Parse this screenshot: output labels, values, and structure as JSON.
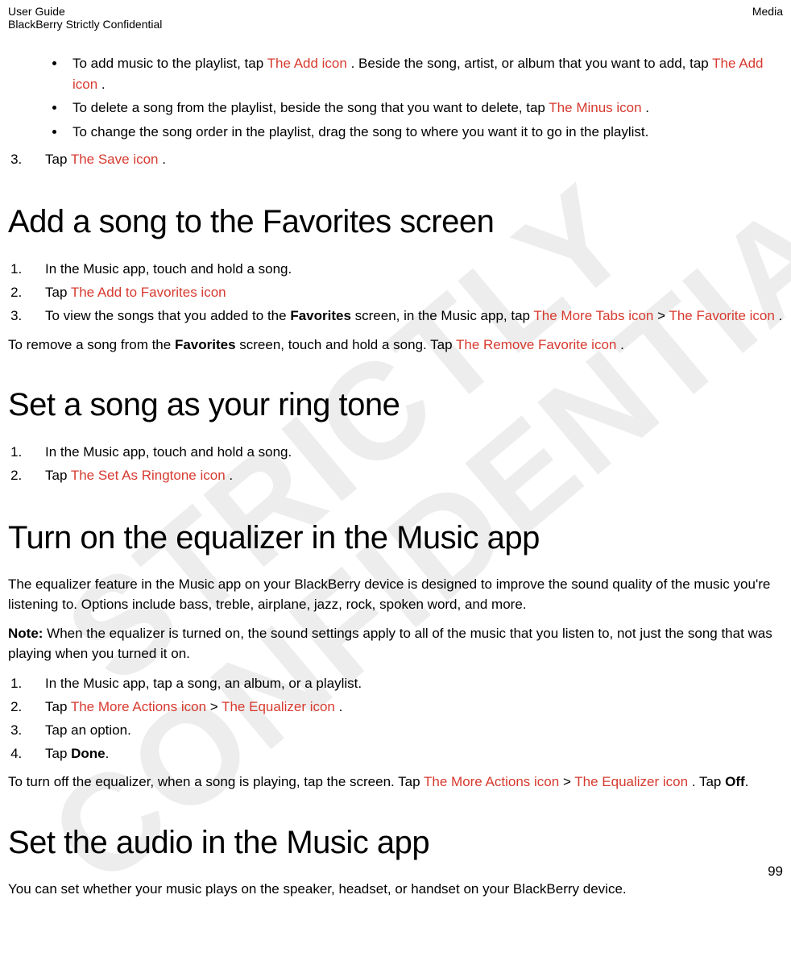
{
  "header": {
    "left1": "User Guide",
    "left2": "BlackBerry Strictly Confidential",
    "right": "Media"
  },
  "watermark": {
    "line1": "STRICTLY",
    "line2": "CONFIDENTIAL"
  },
  "bullets_top": {
    "b1a": "To add music to the playlist, tap ",
    "b1_icon": " The Add icon ",
    "b1b": ". Beside the song, artist, or album that you want to add, tap ",
    "b1_icon2": " The Add icon ",
    "b1c": ".",
    "b2a": "To delete a song from the playlist, beside the song that you want to delete, tap ",
    "b2_icon": " The Minus icon ",
    "b2b": ".",
    "b3": "To change the song order in the playlist, drag the song to where you want it to go in the playlist."
  },
  "step_save": {
    "a": "Tap ",
    "icon": " The Save icon ",
    "b": "."
  },
  "favorites": {
    "heading": "Add a song to the Favorites screen",
    "s1": "In the Music app, touch and hold a song.",
    "s2a": "Tap ",
    "s2_icon": " The Add to Favorites icon",
    "s3a": "To view the songs that you added to the ",
    "s3_bold": "Favorites",
    "s3b": " screen, in the Music app, tap ",
    "s3_icon1": " The More Tabs icon ",
    "s3c": " > ",
    "s3_icon2": " The Favorite icon ",
    "s3d": ".",
    "removeA": "To remove a song from the ",
    "removeBold": "Favorites",
    "removeB": " screen, touch and hold a song. Tap ",
    "removeIcon": " The Remove Favorite icon ",
    "removeC": "."
  },
  "ringtone": {
    "heading": "Set a song as your ring tone",
    "s1": "In the Music app, touch and hold a song.",
    "s2a": "Tap ",
    "s2_icon": " The Set As Ringtone icon ",
    "s2b": "."
  },
  "equalizer": {
    "heading": "Turn on the equalizer in the Music app",
    "p1": "The equalizer feature in the Music app on your BlackBerry device is designed to improve the sound quality of the music you're listening to. Options include bass, treble, airplane, jazz, rock, spoken word, and more.",
    "noteBold": "Note: ",
    "note": "When the equalizer is turned on, the sound settings apply to all of the music that you listen to, not just the song that was playing when you turned it on.",
    "s1": "In the Music app, tap a song, an album, or a playlist.",
    "s2a": "Tap ",
    "s2_icon1": " The More Actions icon ",
    "s2b": " > ",
    "s2_icon2": " The Equalizer icon ",
    "s2c": ".",
    "s3": "Tap an option.",
    "s4a": "Tap ",
    "s4_bold": "Done",
    "s4b": ".",
    "offA": "To turn off the equalizer, when a song is playing, tap the screen. Tap ",
    "offIcon1": " The More Actions icon ",
    "offB": " > ",
    "offIcon2": " The Equalizer icon ",
    "offC": ". Tap ",
    "offBold": "Off",
    "offD": "."
  },
  "audio": {
    "heading": "Set the audio in the Music app",
    "p1": "You can set whether your music plays on the speaker, headset, or handset on your BlackBerry device."
  },
  "pagenum": "99"
}
